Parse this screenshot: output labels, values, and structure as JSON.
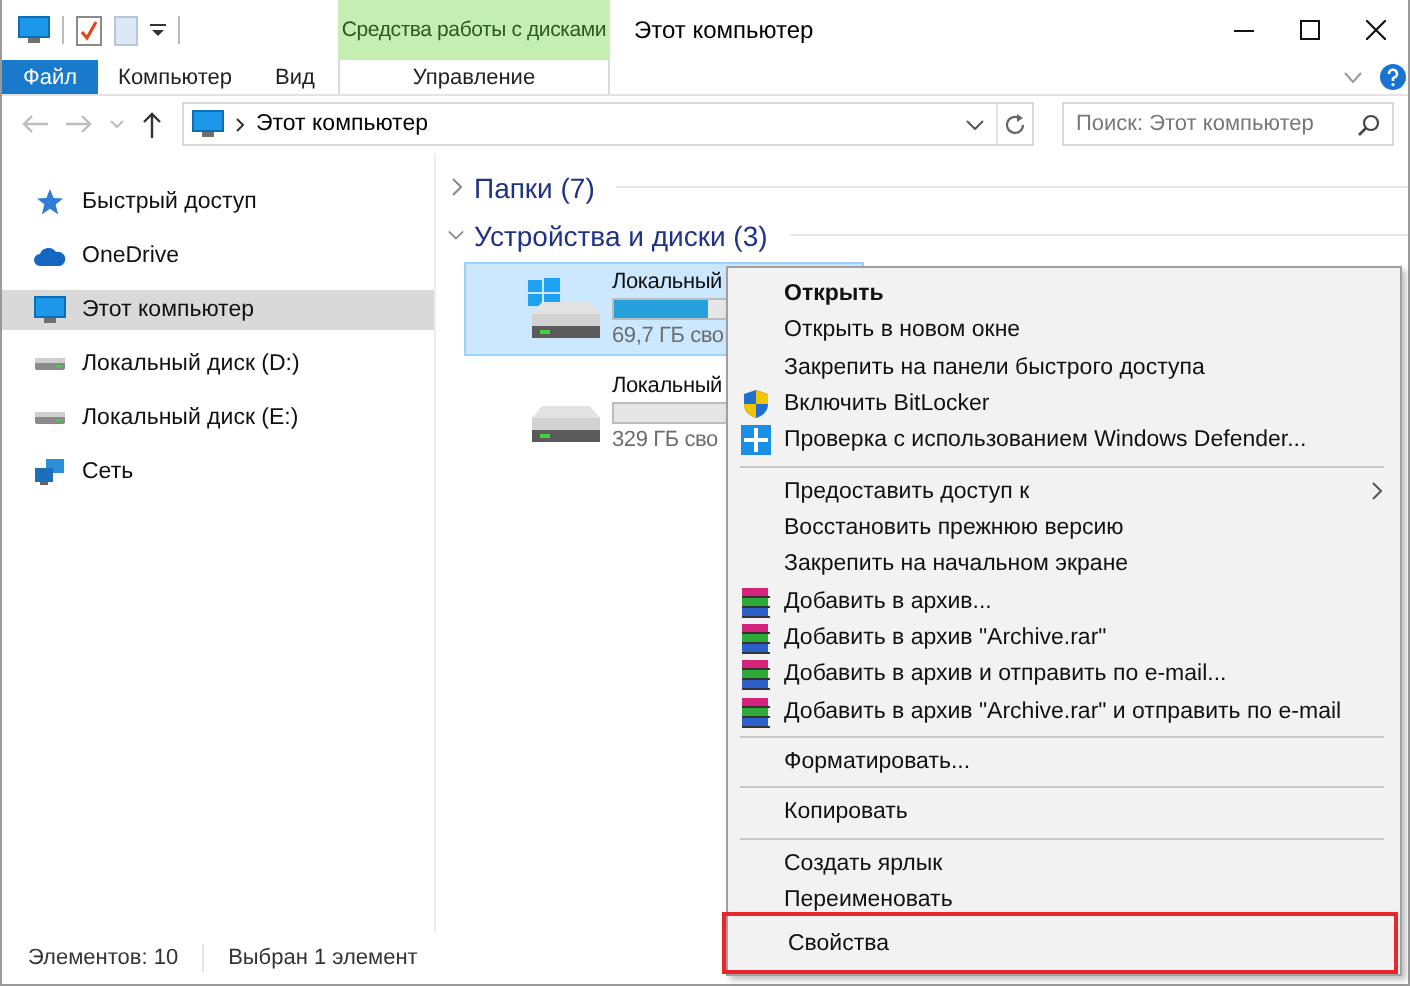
{
  "window": {
    "title": "Этот компьютер",
    "context_header": "Средства работы с дисками"
  },
  "ribbon_tabs": [
    {
      "label": "Файл",
      "kind": "file",
      "selected": false
    },
    {
      "label": "Компьютер",
      "kind": "normal",
      "selected": false
    },
    {
      "label": "Вид",
      "kind": "normal",
      "selected": false
    },
    {
      "label": "Управление",
      "kind": "context",
      "selected": false
    }
  ],
  "address": {
    "path": "Этот компьютер"
  },
  "search": {
    "placeholder": "Поиск: Этот компьютер"
  },
  "nav_items": [
    {
      "label": "Быстрый доступ",
      "kind": "star",
      "selected": false
    },
    {
      "label": "OneDrive",
      "kind": "cloud",
      "selected": false
    },
    {
      "label": "Этот компьютер",
      "kind": "pc",
      "selected": true
    },
    {
      "label": "Локальный диск (D:)",
      "kind": "drive",
      "selected": false
    },
    {
      "label": "Локальный диск (E:)",
      "kind": "drive",
      "selected": false
    },
    {
      "label": "Сеть",
      "kind": "network",
      "selected": false
    }
  ],
  "groups": [
    {
      "title": "Папки (7)",
      "expanded": false
    },
    {
      "title": "Устройства и диски (3)",
      "expanded": true,
      "drives": [
        {
          "name": "Локальный",
          "free": "69,7 ГБ сво",
          "level": 0.4,
          "kind": "system",
          "selected": true
        },
        {
          "name": "Локальный",
          "free": "329 ГБ сво",
          "level": 0,
          "kind": "plain",
          "selected": false
        }
      ]
    }
  ],
  "context_menu": [
    {
      "kind": "plain",
      "label": "Открыть",
      "default": true,
      "submenu": false,
      "highlighted": false
    },
    {
      "kind": "plain",
      "label": "Открыть в новом окне",
      "default": false,
      "submenu": false,
      "highlighted": false
    },
    {
      "kind": "plain",
      "label": "Закрепить на панели быстрого доступа",
      "default": false,
      "submenu": false,
      "highlighted": false
    },
    {
      "kind": "shield",
      "label": "Включить BitLocker",
      "default": false,
      "submenu": false,
      "highlighted": false
    },
    {
      "kind": "scan",
      "label": "Проверка с использованием Windows Defender...",
      "default": false,
      "submenu": false,
      "highlighted": false
    },
    {
      "kind": "separator"
    },
    {
      "kind": "plain",
      "label": "Предоставить доступ к",
      "default": false,
      "submenu": true,
      "highlighted": false
    },
    {
      "kind": "plain",
      "label": "Восстановить прежнюю версию",
      "default": false,
      "submenu": false,
      "highlighted": false
    },
    {
      "kind": "plain",
      "label": "Закрепить на начальном экране",
      "default": false,
      "submenu": false,
      "highlighted": false
    },
    {
      "kind": "archive",
      "label": "Добавить в архив...",
      "default": false,
      "submenu": false,
      "highlighted": false
    },
    {
      "kind": "archive",
      "label": "Добавить в архив \"Archive.rar\"",
      "default": false,
      "submenu": false,
      "highlighted": false
    },
    {
      "kind": "archive",
      "label": "Добавить в архив и отправить по e-mail...",
      "default": false,
      "submenu": false,
      "highlighted": false
    },
    {
      "kind": "archive",
      "label": "Добавить в архив \"Archive.rar\" и отправить по e-mail",
      "default": false,
      "submenu": false,
      "highlighted": false
    },
    {
      "kind": "separator"
    },
    {
      "kind": "plain",
      "label": "Форматировать...",
      "default": false,
      "submenu": false,
      "highlighted": false
    },
    {
      "kind": "separator"
    },
    {
      "kind": "plain",
      "label": "Копировать",
      "default": false,
      "submenu": false,
      "highlighted": false
    },
    {
      "kind": "separator"
    },
    {
      "kind": "plain",
      "label": "Создать ярлык",
      "default": false,
      "submenu": false,
      "highlighted": false
    },
    {
      "kind": "plain",
      "label": "Переименовать",
      "default": false,
      "submenu": false,
      "highlighted": false
    },
    {
      "kind": "plain",
      "label": "Свойства",
      "default": false,
      "submenu": false,
      "highlighted": true
    }
  ],
  "status_bar": {
    "count": "Элементов: 10",
    "selection": "Выбран 1 элемент"
  }
}
